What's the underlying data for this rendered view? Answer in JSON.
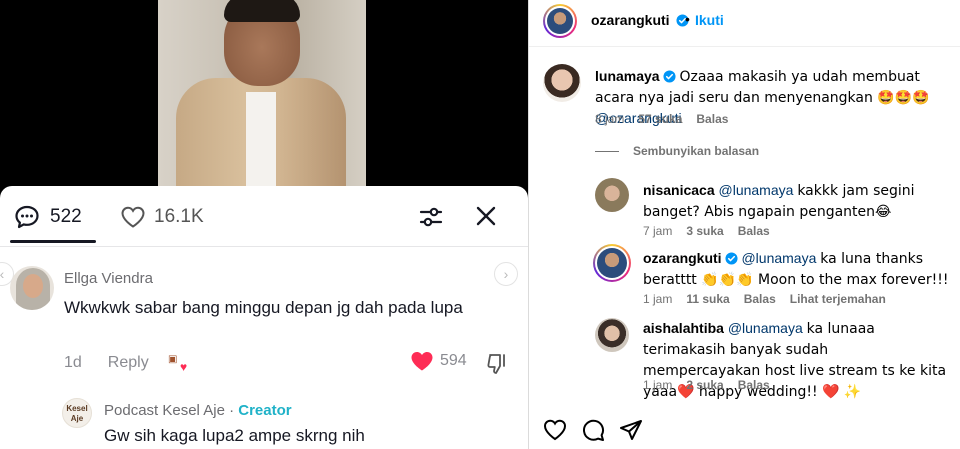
{
  "tiktok": {
    "tabs": {
      "comments_count": "522",
      "likes_count": "16.1K"
    },
    "comment1": {
      "name": "Ellga Viendra",
      "text": "Wkwkwk sabar bang minggu depan jg dah pada lupa",
      "time": "1d",
      "reply_label": "Reply",
      "like_count": "594"
    },
    "comment2": {
      "name": "Podcast Kesel Aje",
      "separator": " · ",
      "badge": "Creator",
      "text": "Gw sih kaga lupa2 ampe skrng nih",
      "avatar_text": "Kesel Aje"
    }
  },
  "instagram": {
    "header": {
      "username": "ozarangkuti",
      "dot": "•",
      "follow_label": "Ikuti"
    },
    "main_comment": {
      "username": "lunamaya",
      "text": "Ozaaa makasih ya udah membuat acara nya jadi seru dan menyenangkan 🤩🤩🤩",
      "mention": "@ozarangkuti",
      "time": "8 jam",
      "likes": "57 suka",
      "reply": "Balas"
    },
    "hide_replies_label": "Sembunyikan balasan",
    "replies": [
      {
        "username": "nisanicaca",
        "mention": "@lunamaya",
        "text": "kakkk jam segini banget? Abis ngapain penganten😂",
        "time": "7 jam",
        "likes": "3 suka",
        "reply": "Balas",
        "translate": ""
      },
      {
        "username": "ozarangkuti",
        "mention": "@lunamaya",
        "text": "ka luna thanks beratttt 👏👏👏 Moon to the max forever!!!",
        "time": "1 jam",
        "likes": "11 suka",
        "reply": "Balas",
        "translate": "Lihat terjemahan"
      },
      {
        "username": "aishalahtiba",
        "mention": "@lunamaya",
        "text": "ka lunaaa terimakasih banyak sudah mempercayakan host live stream ts ke kita yaaa❤️ happy wedding!! ❤️ ✨",
        "time": "1 jam",
        "likes": "2 suka",
        "reply": "Balas",
        "translate": ""
      }
    ]
  },
  "colors": {
    "tiktok_heart": "#fe2c55",
    "tiktok_creator": "#20b2c8",
    "ig_blue": "#0095f6",
    "ig_mention": "#00376b",
    "ig_meta": "#737373"
  }
}
